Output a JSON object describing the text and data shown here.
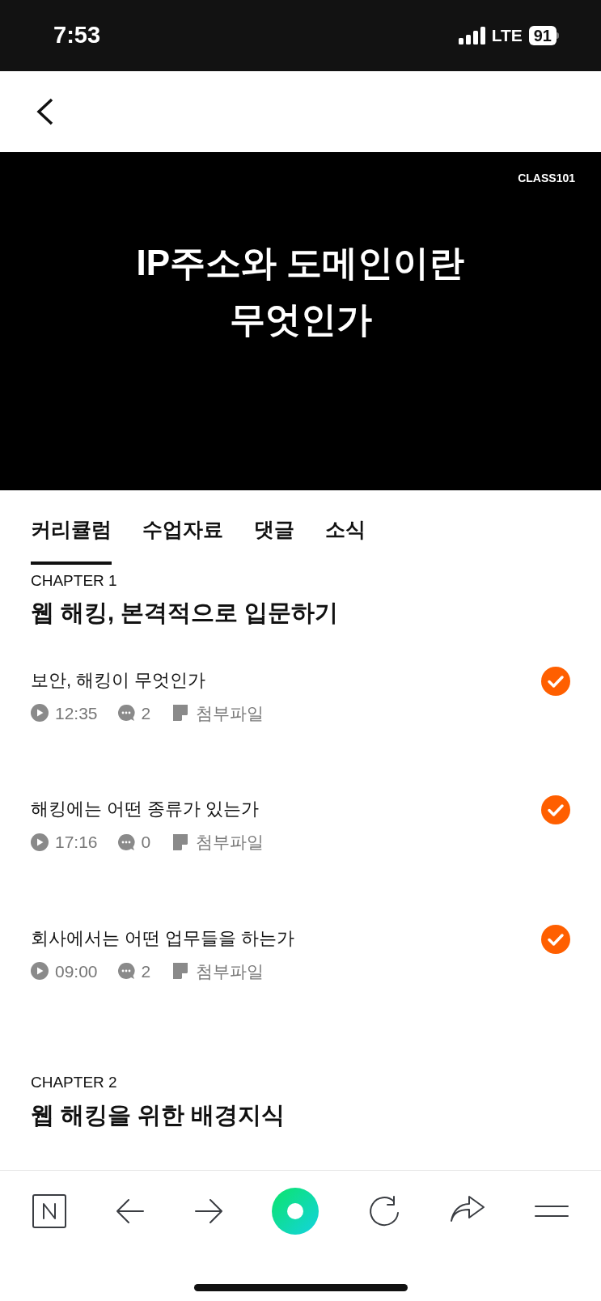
{
  "status_bar": {
    "time": "7:53",
    "network": "LTE",
    "battery": "91"
  },
  "video": {
    "logo": "CLASS101",
    "title_lines": [
      "IP주소와 도메인이란",
      "무엇인가"
    ]
  },
  "tabs": [
    {
      "label": "커리큘럼",
      "selected": true
    },
    {
      "label": "수업자료",
      "selected": false
    },
    {
      "label": "댓글",
      "selected": false
    },
    {
      "label": "소식",
      "selected": false
    }
  ],
  "chapters": [
    {
      "label": "CHAPTER 1",
      "title": "웹 해킹, 본격적으로 입문하기",
      "lessons": [
        {
          "title": "보안, 해킹이 무엇인가",
          "duration": "12:35",
          "comments": "2",
          "attachment": "첨부파일",
          "completed": true
        },
        {
          "title": "해킹에는 어떤 종류가 있는가",
          "duration": "17:16",
          "comments": "0",
          "attachment": "첨부파일",
          "completed": true
        },
        {
          "title": "회사에서는 어떤 업무들을 하는가",
          "duration": "09:00",
          "comments": "2",
          "attachment": "첨부파일",
          "completed": true
        }
      ]
    },
    {
      "label": "CHAPTER 2",
      "title": "웹 해킹을 위한 배경지식"
    }
  ]
}
